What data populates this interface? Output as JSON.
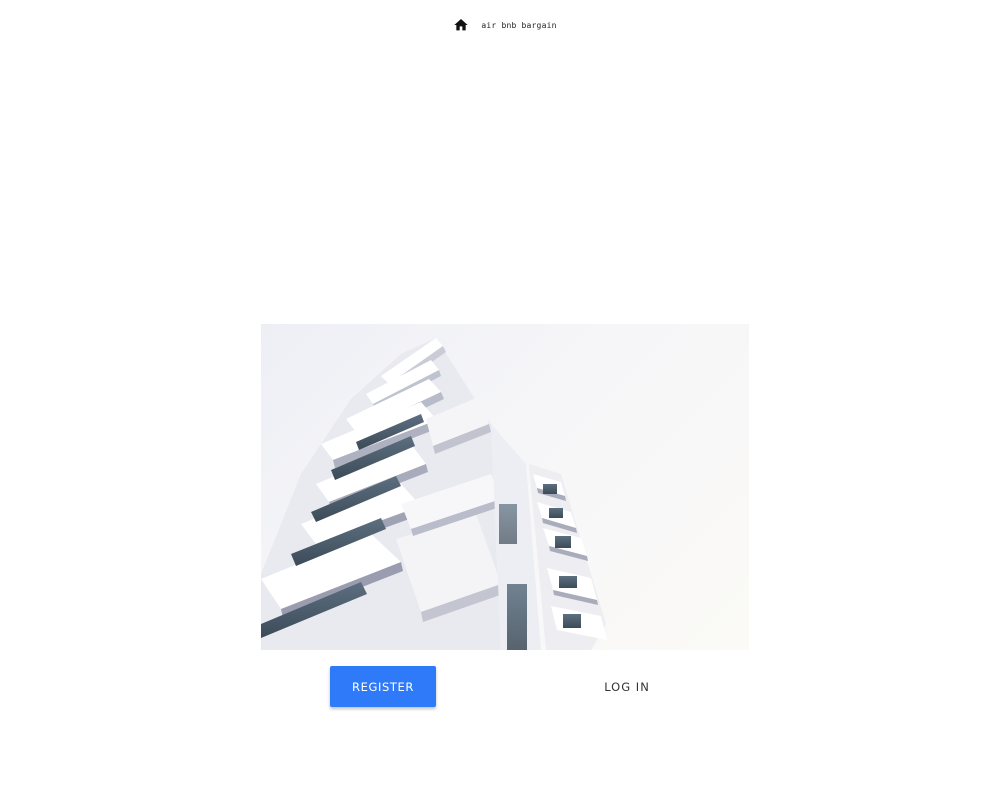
{
  "header": {
    "icon": "home-icon",
    "brand_name": "air bnb bargain"
  },
  "hero": {
    "image": "modern white apartment building photographed from below"
  },
  "actions": {
    "register_label": "REGISTER",
    "login_label": "LOG IN"
  },
  "colors": {
    "primary": "#2f7af8",
    "background": "#ffffff",
    "text": "#333333"
  }
}
